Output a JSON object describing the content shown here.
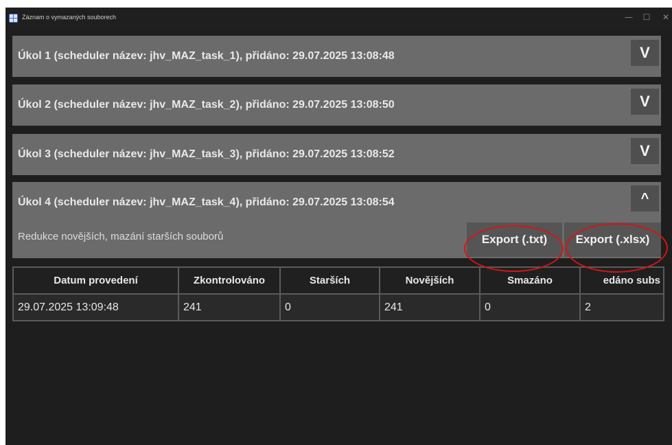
{
  "window": {
    "title": "Záznam o vymazaných souborech",
    "controls": {
      "minimize": "—",
      "maximize": "☐",
      "close": "✕"
    }
  },
  "tasks": [
    {
      "title": "Úkol 1 (scheduler název: jhv_MAZ_task_1), přidáno: 29.07.2025 13:08:48",
      "toggle": "V"
    },
    {
      "title": "Úkol 2 (scheduler název: jhv_MAZ_task_2), přidáno: 29.07.2025 13:08:50",
      "toggle": "V"
    },
    {
      "title": "Úkol 3 (scheduler název: jhv_MAZ_task_3), přidáno: 29.07.2025 13:08:52",
      "toggle": "V"
    },
    {
      "title": "Úkol 4 (scheduler název: jhv_MAZ_task_4), přidáno: 29.07.2025 13:08:54",
      "toggle": "^",
      "description": "Redukce novějších, mazání starších souborů",
      "export_txt": "Export (.txt)",
      "export_xlsx": "Export (.xlsx)",
      "table": {
        "headers": [
          "Datum provedení",
          "Zkontrolováno",
          "Starších",
          "Novějších",
          "Smazáno",
          "edáno subs"
        ],
        "rows": [
          [
            "29.07.2025 13:09:48",
            "241",
            "0",
            "241",
            "0",
            "2"
          ]
        ]
      }
    }
  ],
  "colors": {
    "window_bg": "#1e1e1e",
    "task_header": "#6b6b6b",
    "button": "#555555",
    "highlight_ring": "#d81414"
  }
}
